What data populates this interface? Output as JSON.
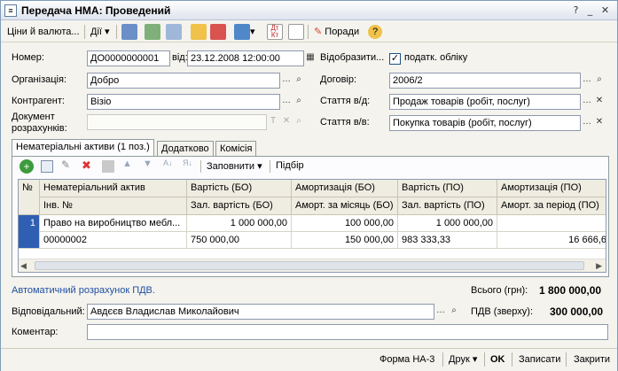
{
  "window": {
    "title": "Передача НМА: Проведений"
  },
  "toolbar": {
    "prices_currency": "Ціни й валюта...",
    "actions": "Дії",
    "advice": "Поради",
    "debit_credit_icon_text": "Дт Кт"
  },
  "form": {
    "number_label": "Номер:",
    "number_value": "ДО0000000001",
    "date_label": "від:",
    "date_value": "23.12.2008 12:00:00",
    "reflect_label": "Відобразити...",
    "tax_accounting_label": "податк. обліку",
    "tax_accounting_checked": true,
    "organization_label": "Організація:",
    "organization_value": "Добро",
    "contract_label": "Договір:",
    "contract_value": "2006/2",
    "counterparty_label": "Контрагент:",
    "counterparty_value": "Візіо",
    "article_vd_label": "Стаття в/д:",
    "article_vd_value": "Продаж товарів (робіт, послуг)",
    "settlement_doc_label_1": "Документ",
    "settlement_doc_label_2": "розрахунків:",
    "settlement_doc_value": "",
    "article_vv_label": "Стаття в/в:",
    "article_vv_value": "Покупка товарів (робіт, послуг)"
  },
  "tabs": [
    {
      "label": "Нематеріальні активи (1 поз.)"
    },
    {
      "label": "Додатково"
    },
    {
      "label": "Комісія"
    }
  ],
  "table_toolbar": {
    "fill": "Заповнити",
    "select": "Підбір"
  },
  "table": {
    "headers_row1": [
      "№",
      "Нематеріальний актив",
      "Вартість (БО)",
      "Амортизація (БО)",
      "Вартість (ПО)",
      "Амортизація (ПО)"
    ],
    "headers_row2": [
      "Інв. №",
      "Зал. вартість (БО)",
      "Аморт. за місяць (БО)",
      "Зал. вартість (ПО)",
      "Аморт. за період (ПО)"
    ],
    "rows": [
      {
        "no": "1",
        "asset": "Право на виробництво мебл...",
        "cost_bo": "1 000 000,00",
        "amort_bo": "100 000,00",
        "cost_po": "1 000 000,00",
        "amort_po": "",
        "inv_no": "00000002",
        "residual_bo": "750 000,00",
        "amort_month_bo": "150 000,00",
        "residual_po": "983 333,33",
        "amort_period_po": "16 666,6"
      }
    ]
  },
  "footer": {
    "auto_vat_link": "Автоматичний розрахунок ПДВ.",
    "total_label": "Всього (грн):",
    "total_value": "1 800 000,00",
    "responsible_label": "Відповідальний:",
    "responsible_value": "Авдєєв Владислав Миколайович",
    "vat_label": "ПДВ (зверху):",
    "vat_value": "300 000,00",
    "comment_label": "Коментар:",
    "comment_value": ""
  },
  "bottom_bar": {
    "form_na3": "Форма НА-3",
    "print": "Друк",
    "ok": "OK",
    "save": "Записати",
    "close": "Закрити"
  },
  "colors": {
    "accent": "#1f4fa0",
    "selection": "#2f5fb3",
    "window_bg": "#f4f3ee"
  }
}
